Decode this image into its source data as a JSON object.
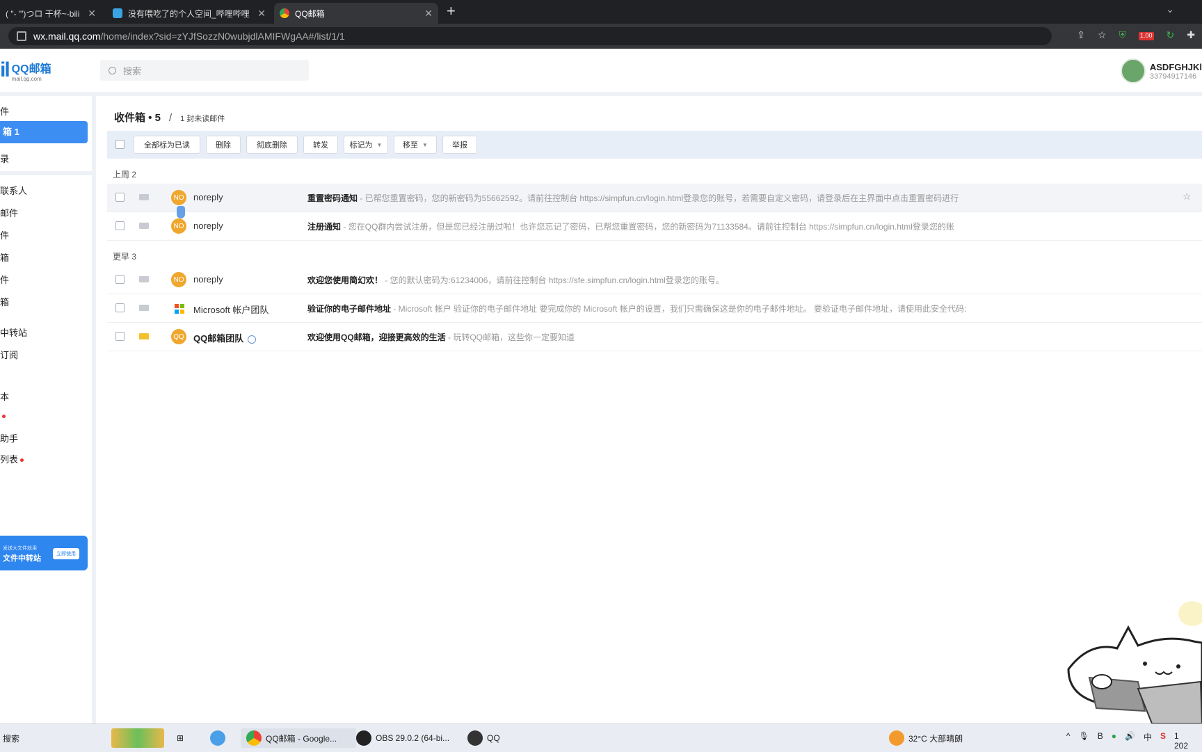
{
  "browser": {
    "tabs": [
      {
        "title": "( \"- \"′)つロ 干杯~-bili",
        "active": false
      },
      {
        "title": "没有喂吃了的个人空间_哔哩哔哩",
        "active": false
      },
      {
        "title": "QQ邮箱",
        "active": true
      }
    ],
    "new_tab": "+",
    "url_host": "wx.mail.qq.com",
    "url_path": "/home/index?sid=zYJfSozzN0wubjdlAMIFWgAA#/list/1/1",
    "ext_badge": "1.00"
  },
  "header": {
    "logo_mark": "il",
    "logo_text": "QQ邮箱",
    "logo_sub": "mail.qq.com",
    "search_placeholder": "搜索",
    "user_name": "ASDFGHJKl",
    "user_id": "33794917146"
  },
  "sidebar": {
    "items": [
      {
        "label": "件"
      },
      {
        "label": "箱 1"
      },
      {
        "label": "录"
      },
      {
        "label": "联系人"
      },
      {
        "label": "邮件"
      },
      {
        "label": "件"
      },
      {
        "label": "箱"
      },
      {
        "label": "件"
      },
      {
        "label": "箱"
      },
      {
        "label": "中转站"
      },
      {
        "label": "订阅"
      },
      {
        "label": "本"
      },
      {
        "label": ""
      },
      {
        "label": "助手"
      },
      {
        "label": "列表"
      }
    ],
    "banner_small": "发送大文件就用",
    "banner_title": "文件中转站",
    "banner_button": "立即使用"
  },
  "inbox": {
    "title": "收件箱 • 5",
    "slash": "/",
    "unread_text": "1 封未读邮件"
  },
  "toolbar": {
    "mark_all_read": "全部标为已读",
    "delete": "删除",
    "delete_forever": "彻底删除",
    "forward": "转发",
    "mark_as": "标记为",
    "move_to": "移至",
    "report": "举报"
  },
  "groups": [
    {
      "label": "上周 2"
    },
    {
      "label": "更早 3"
    }
  ],
  "emails": [
    {
      "sender": "noreply",
      "avatar": "NO",
      "subject": "重置密码通知",
      "preview": " - 已帮您重置密码，您的新密码为55662592。请前往控制台 https://simpfun.cn/login.html登录您的账号，若需要自定义密码，请登录后在主界面中点击重置密码进行",
      "unread": false
    },
    {
      "sender": "noreply",
      "avatar": "NO",
      "subject": "注册通知",
      "preview": " - 您在QQ群内尝试注册，但是您已经注册过啦！也许您忘记了密码，已帮您重置密码，您的新密码为71133584。请前往控制台 https://simpfun.cn/login.html登录您的账",
      "unread": false
    },
    {
      "sender": "noreply",
      "avatar": "NO",
      "subject": "欢迎您使用简幻欢！",
      "preview": " - 您的默认密码为:61234006，请前往控制台 https://sfe.simpfun.cn/login.html登录您的账号。",
      "unread": false
    },
    {
      "sender": "Microsoft 帐户团队",
      "avatar": "",
      "subject": "验证你的电子邮件地址",
      "preview": " - Microsoft 帐户 验证你的电子邮件地址 要完成你的 Microsoft 帐户的设置，我们只需确保这是你的电子邮件地址。 要验证电子邮件地址，请使用此安全代码:",
      "unread": false
    },
    {
      "sender": "QQ邮箱团队",
      "avatar": "QQ",
      "subject": "欢迎使用QQ邮箱，迎接更高效的生活",
      "preview": " - 玩转QQ邮箱，这些你一定要知道",
      "unread": true
    }
  ],
  "taskbar": {
    "search": "搜索",
    "apps": [
      {
        "label": "QQ邮箱 - Google..."
      },
      {
        "label": "OBS 29.0.2 (64-bi..."
      },
      {
        "label": "QQ"
      }
    ],
    "weather": "32°C 大部晴朗",
    "ime": "中",
    "time": "1",
    "date": "202"
  },
  "colors": {
    "accent": "#3d8ef3",
    "avatar_orange": "#f0a72e",
    "toolbar_bg": "#e8eef8",
    "unread_envelope": "#f3c12c"
  }
}
